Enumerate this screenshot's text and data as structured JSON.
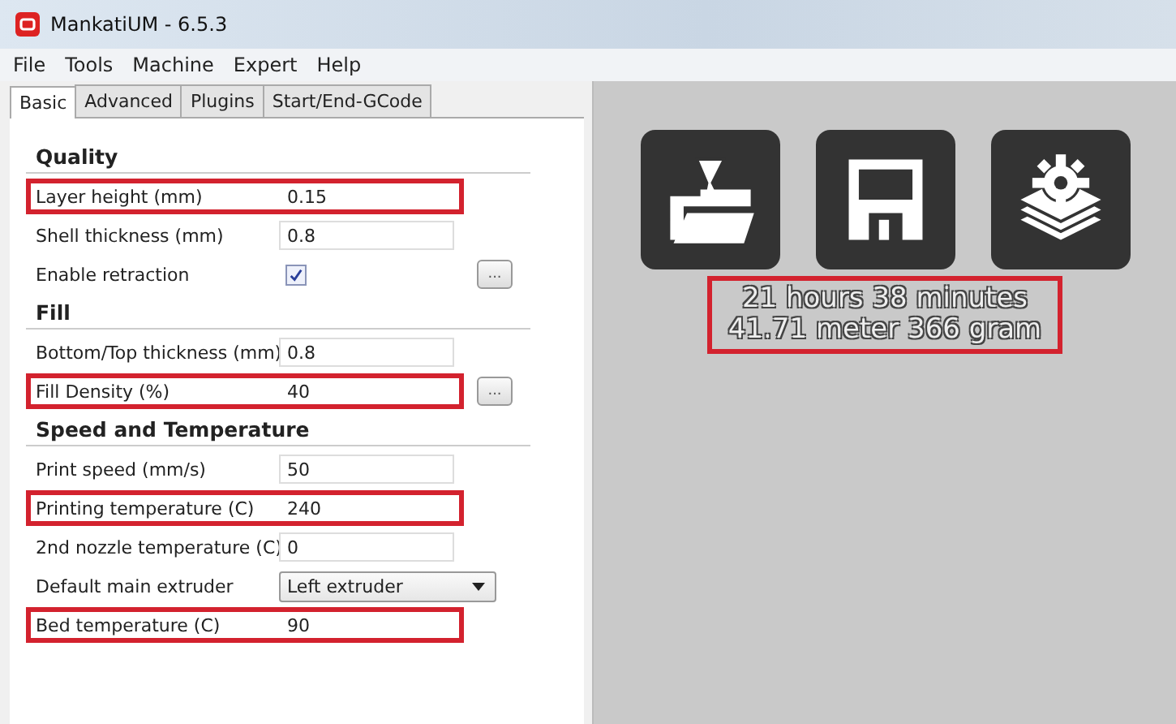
{
  "window": {
    "title": "MankatiUM - 6.5.3"
  },
  "menu": [
    "File",
    "Tools",
    "Machine",
    "Expert",
    "Help"
  ],
  "tabs": [
    {
      "label": "Basic",
      "selected": true
    },
    {
      "label": "Advanced",
      "selected": false
    },
    {
      "label": "Plugins",
      "selected": false
    },
    {
      "label": "Start/End-GCode",
      "selected": false
    }
  ],
  "sections": [
    {
      "title": "Quality",
      "rows": [
        {
          "kind": "text",
          "label": "Layer height (mm)",
          "value": "0.15",
          "highlighted": true
        },
        {
          "kind": "text",
          "label": "Shell thickness (mm)",
          "value": "0.8",
          "highlighted": false
        },
        {
          "kind": "checkbox",
          "label": "Enable retraction",
          "checked": true,
          "highlighted": false,
          "more_label": "..."
        }
      ]
    },
    {
      "title": "Fill",
      "rows": [
        {
          "kind": "text",
          "label": "Bottom/Top thickness (mm)",
          "value": "0.8",
          "highlighted": false
        },
        {
          "kind": "text",
          "label": "Fill Density (%)",
          "value": "40",
          "highlighted": true,
          "more_label": "..."
        }
      ]
    },
    {
      "title": "Speed and Temperature",
      "rows": [
        {
          "kind": "text",
          "label": "Print speed (mm/s)",
          "value": "50",
          "highlighted": false
        },
        {
          "kind": "text",
          "label": "Printing temperature (C)",
          "value": "240",
          "highlighted": true
        },
        {
          "kind": "text",
          "label": "2nd nozzle temperature (C)",
          "value": "0",
          "highlighted": false
        },
        {
          "kind": "select",
          "label": "Default main extruder",
          "value": "Left extruder",
          "highlighted": false
        },
        {
          "kind": "text",
          "label": "Bed temperature (C)",
          "value": "90",
          "highlighted": true
        }
      ]
    }
  ],
  "toolbar": [
    {
      "kind": "load"
    },
    {
      "kind": "save"
    },
    {
      "kind": "settings"
    }
  ],
  "estimate": {
    "lines": [
      "21 hours 38 minutes",
      "41.71 meter 366 gram"
    ],
    "highlighted": true
  }
}
